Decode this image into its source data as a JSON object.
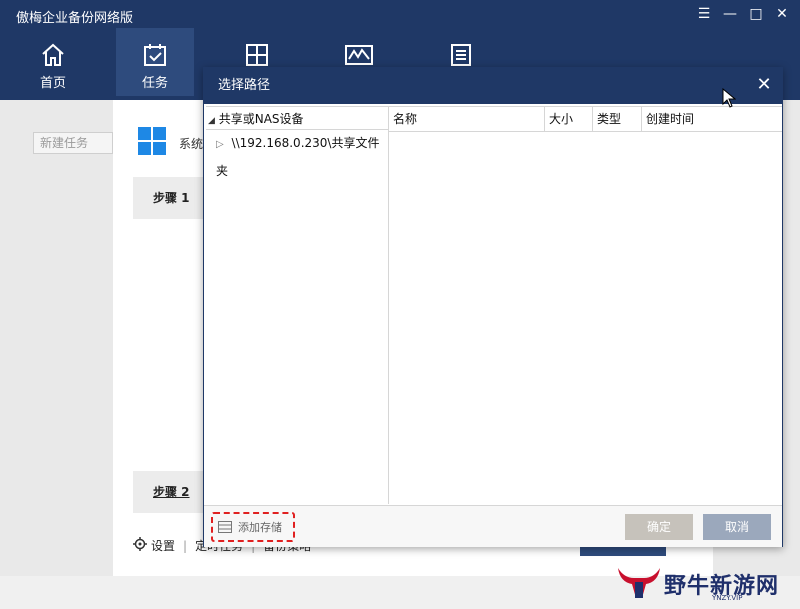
{
  "app": {
    "title": "傲梅企业备份网络版",
    "window_controls": {
      "menu": "☰",
      "minimize": "—",
      "maximize": "□",
      "close": "✕"
    }
  },
  "nav": [
    {
      "label": "首页",
      "icon": "home-icon"
    },
    {
      "label": "任务",
      "icon": "tasks-icon",
      "active": true
    },
    {
      "label": "",
      "icon": "windows-icon"
    },
    {
      "label": "",
      "icon": "monitor-icon"
    },
    {
      "label": "",
      "icon": "list-icon"
    }
  ],
  "background": {
    "new_task_placeholder": "新建任务",
    "system_text": "系统",
    "step1": "步骤 1",
    "step2": "步骤 2",
    "bottom": {
      "settings": "设置",
      "schedule": "定时任务",
      "strategy": "备份策略"
    }
  },
  "dialog": {
    "title": "选择路径",
    "tree": {
      "root": "共享或NAS设备",
      "children": [
        "\\\\192.168.0.230\\共享文件夹"
      ]
    },
    "columns": {
      "name": "名称",
      "size": "大小",
      "type": "类型",
      "created": "创建时间"
    },
    "add_storage": "添加存储",
    "ok": "确定",
    "cancel": "取消"
  },
  "colors": {
    "header": "#1f3866",
    "nav_active": "#2e4b7d",
    "highlight": "#e02020"
  },
  "watermark": {
    "text": "野牛新游网",
    "sub": "YNZY.VIP"
  }
}
